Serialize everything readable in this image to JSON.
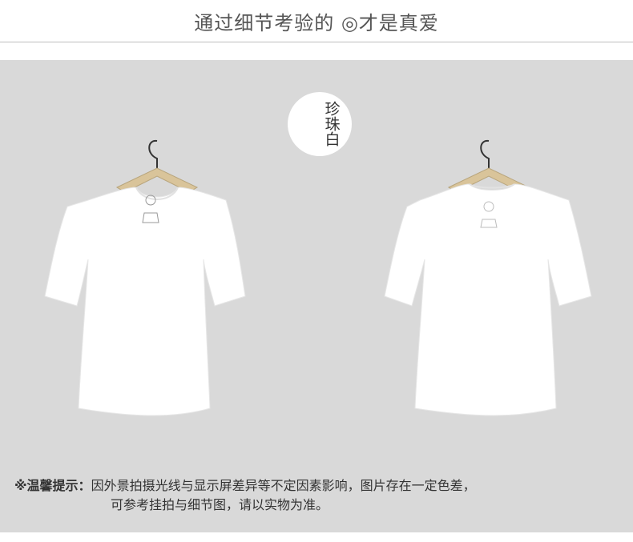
{
  "header": {
    "title": "通过细节考验的 ◎才是真爱"
  },
  "color_badge": {
    "label": "珍珠白"
  },
  "notice": {
    "prefix": "※温馨提示：",
    "line1": "因外景拍摄光线与显示屏差异等不定因素影响，图片存在一定色差，",
    "line2": "可参考挂拍与细节图，请以实物为准。"
  },
  "products": [
    {
      "view": "front",
      "icon": "tshirt-front-icon"
    },
    {
      "view": "back",
      "icon": "tshirt-back-icon"
    }
  ],
  "colors": {
    "panel": "#d9d9d9",
    "hanger_wood": "#d9c49a",
    "shirt": "#ffffff"
  }
}
